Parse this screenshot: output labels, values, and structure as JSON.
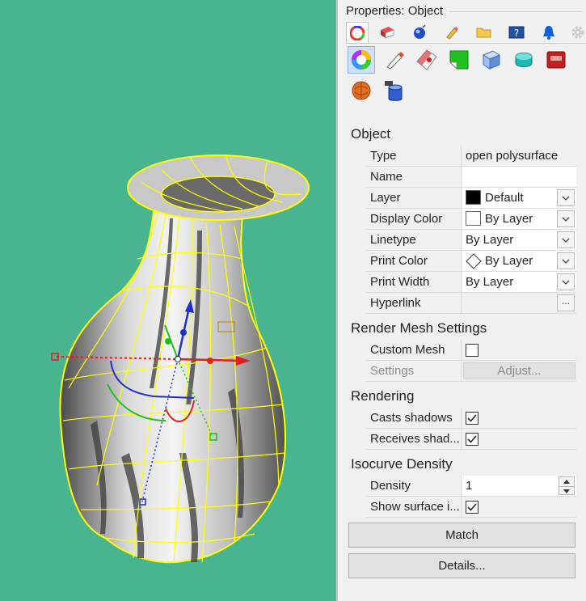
{
  "panel": {
    "title": "Properties: Object"
  },
  "tabs": [
    {
      "icon": "color-wheel-icon",
      "active": true
    },
    {
      "icon": "material-book-icon"
    },
    {
      "icon": "environment-sphere-icon"
    },
    {
      "icon": "pencil-brush-icon"
    },
    {
      "icon": "folder-icon"
    },
    {
      "icon": "help-icon"
    },
    {
      "icon": "notification-bell-icon"
    },
    {
      "icon": "settings-gear-icon"
    }
  ],
  "object_icons": [
    "object-color-wheel-icon",
    "paint-tube-icon",
    "texture-mapping-icon",
    "decal-icon",
    "shadow-box-icon",
    "pill-shape-icon",
    "render-box-icon",
    "brain-sphere-icon",
    "cylinder-db-icon"
  ],
  "sections": {
    "object": "Object",
    "render_mesh": "Render Mesh Settings",
    "rendering": "Rendering",
    "isocurve": "Isocurve Density"
  },
  "object_props": {
    "type_label": "Type",
    "type_value": "open polysurface",
    "name_label": "Name",
    "name_value": "",
    "layer_label": "Layer",
    "layer_value": "Default",
    "layer_color": "#000000",
    "display_color_label": "Display Color",
    "display_color_value": "By Layer",
    "display_color_swatch": "#ffffff",
    "linetype_label": "Linetype",
    "linetype_value": "By Layer",
    "print_color_label": "Print Color",
    "print_color_value": "By Layer",
    "print_width_label": "Print Width",
    "print_width_value": "By Layer",
    "hyperlink_label": "Hyperlink",
    "hyperlink_value": "",
    "hyperlink_button": "..."
  },
  "render_mesh": {
    "custom_mesh_label": "Custom Mesh",
    "custom_mesh_checked": false,
    "settings_label": "Settings",
    "adjust_button": "Adjust..."
  },
  "rendering": {
    "casts_label": "Casts shadows",
    "casts_checked": true,
    "receives_label": "Receives shad...",
    "receives_checked": true
  },
  "isocurve": {
    "density_label": "Density",
    "density_value": "1",
    "show_surface_label": "Show surface i...",
    "show_surface_checked": true
  },
  "buttons": {
    "match": "Match",
    "details": "Details..."
  },
  "colors": {
    "viewport_bg": "#48b490",
    "wireframe": "#ffff00",
    "panel_bg": "#f0f0f0"
  }
}
